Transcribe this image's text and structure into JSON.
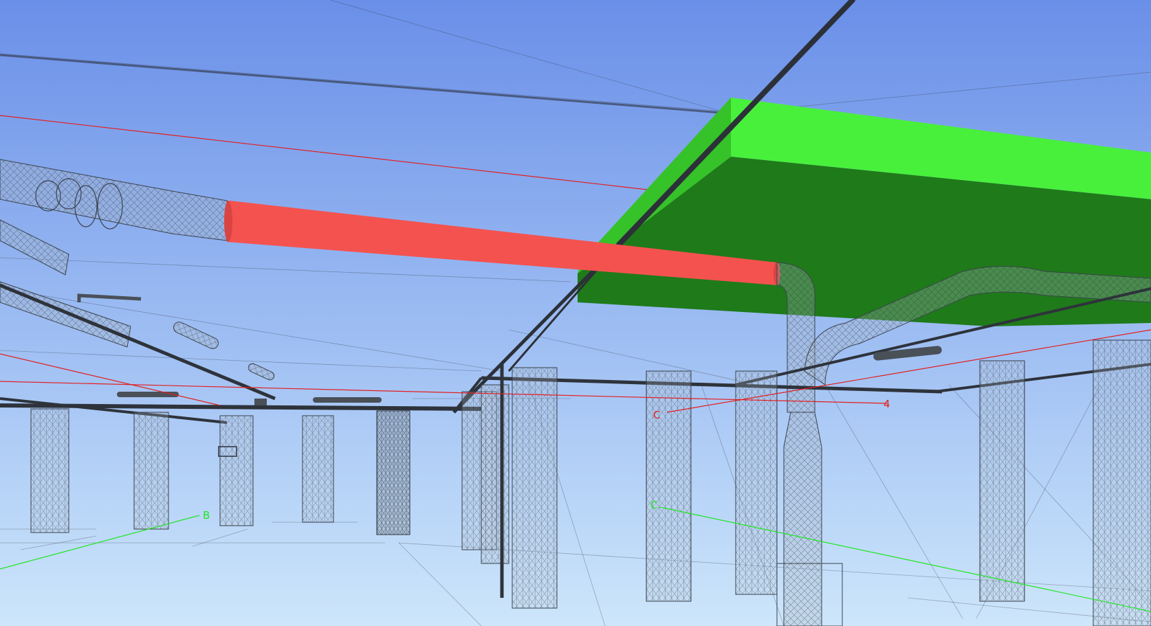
{
  "viewport": {
    "sky_top_color": "#6a8fe8",
    "sky_bottom_color": "#c9e4fb",
    "highlighted_pipe_color": "#f4524f",
    "slab_top_color": "#48f03c",
    "slab_side_color": "#1f7a1a",
    "grid_axis_red": "#e41e1e",
    "grid_axis_green": "#1ee61e"
  },
  "grid_labels": {
    "red_c": "C",
    "red_4": "4",
    "green_b": "B",
    "green_c": "C"
  },
  "icons": {
    "grid_bubble": "grid-bubble-icon"
  }
}
